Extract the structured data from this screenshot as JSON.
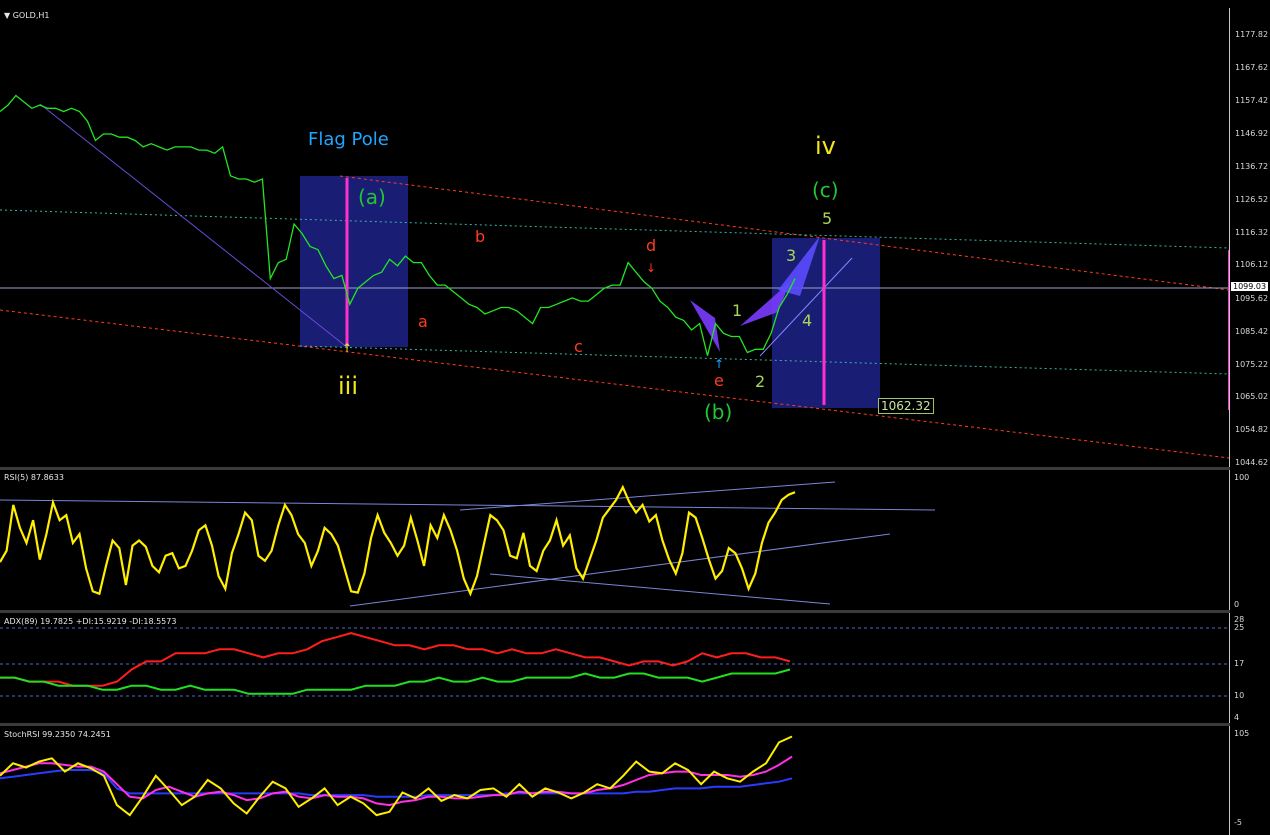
{
  "chart_data": [
    {
      "type": "line",
      "title": "GOLD,H1",
      "y_ticks": [
        "1177.82",
        "1167.62",
        "1157.42",
        "1146.92",
        "1136.72",
        "1126.52",
        "1116.32",
        "1106.12",
        "1095.62",
        "1085.42",
        "1075.22",
        "1065.02",
        "1054.82",
        "1044.62"
      ],
      "ylim": [
        1044.62,
        1177.82
      ],
      "current_price": "1099.03",
      "target_label": "1062.32",
      "annotations": {
        "flag_pole": "Flag Pole",
        "wave_iv": "iv",
        "wave_iii": "iii",
        "wave_a_paren": "(a)",
        "wave_b_paren": "(b)",
        "wave_c_paren": "(c)",
        "a": "a",
        "b": "b",
        "c": "c",
        "d": "d",
        "e": "e",
        "n1": "1",
        "n2": "2",
        "n3": "3",
        "n4": "4",
        "n5": "5"
      },
      "price_series": [
        1154,
        1156,
        1159,
        1157,
        1155,
        1156,
        1155,
        1155,
        1154,
        1155,
        1154,
        1151,
        1145,
        1147,
        1147,
        1146,
        1146,
        1145,
        1143,
        1144,
        1143,
        1142,
        1143,
        1143,
        1143,
        1142,
        1142,
        1141,
        1143,
        1134,
        1133,
        1133,
        1132,
        1133,
        1102,
        1107,
        1108,
        1119,
        1116,
        1112,
        1111,
        1106,
        1102,
        1103,
        1094,
        1099,
        1101,
        1103,
        1104,
        1108,
        1106,
        1109,
        1107,
        1107,
        1103,
        1100,
        1100,
        1098,
        1096,
        1094,
        1093,
        1091,
        1092,
        1093,
        1093,
        1092,
        1090,
        1088,
        1093,
        1093,
        1094,
        1095,
        1096,
        1095,
        1095,
        1097,
        1099,
        1100,
        1100,
        1107,
        1104,
        1101,
        1099,
        1095,
        1093,
        1090,
        1089,
        1086,
        1088,
        1078,
        1088,
        1085,
        1084,
        1084,
        1079,
        1080,
        1080,
        1085,
        1093,
        1097,
        1102
      ],
      "colors": {
        "price": "#22e622",
        "channel": "#ff3b1f",
        "dotted": "#38b3a8",
        "box": "#1b1f7a",
        "pink": "#ff2fd0",
        "fib": "#7a3cff",
        "label_green": "#22c535",
        "label_yellow": "#f2e61a",
        "label_red": "#ff3b1f",
        "label_blue": "#1fa6ff"
      }
    },
    {
      "type": "line",
      "title": "RSI(5) 87.8633",
      "y_ticks": [
        "100",
        "0"
      ],
      "ylim": [
        0,
        100
      ],
      "values": [
        33,
        42,
        78,
        60,
        48,
        66,
        35,
        55,
        80,
        66,
        70,
        48,
        55,
        28,
        10,
        8,
        30,
        50,
        44,
        15,
        46,
        50,
        45,
        30,
        25,
        38,
        40,
        28,
        30,
        42,
        58,
        62,
        46,
        22,
        12,
        40,
        55,
        72,
        66,
        38,
        34,
        42,
        62,
        78,
        70,
        55,
        48,
        30,
        42,
        60,
        55,
        46,
        28,
        10,
        9,
        24,
        52,
        70,
        56,
        48,
        38,
        46,
        68,
        50,
        30,
        62,
        52,
        70,
        58,
        42,
        20,
        8,
        22,
        46,
        70,
        66,
        58,
        38,
        36,
        56,
        30,
        26,
        42,
        50,
        66,
        46,
        54,
        28,
        20,
        35,
        50,
        68,
        75,
        82,
        92,
        80,
        72,
        78,
        65,
        70,
        50,
        35,
        24,
        40,
        72,
        68,
        52,
        35,
        20,
        26,
        44,
        40,
        28,
        12,
        24,
        48,
        64,
        72,
        82,
        86,
        88
      ],
      "color": "#ffee00"
    },
    {
      "type": "line",
      "title": "ADX(89) 19.7825 +DI:15.9219 -DI:18.5573",
      "y_ticks": [
        "28",
        "25",
        "17",
        "10",
        "4"
      ],
      "ylim": [
        4,
        28
      ],
      "series": [
        {
          "name": "+DI",
          "color": "#20e020",
          "values": [
            14,
            14,
            13,
            13,
            12,
            12,
            12,
            11,
            11,
            12,
            12,
            11,
            11,
            12,
            11,
            11,
            11,
            10,
            10,
            10,
            10,
            11,
            11,
            11,
            11,
            12,
            12,
            12,
            13,
            13,
            14,
            13,
            13,
            14,
            13,
            13,
            14,
            14,
            14,
            14,
            15,
            14,
            14,
            15,
            15,
            14,
            14,
            14,
            13,
            14,
            15,
            15,
            15,
            15,
            16
          ]
        },
        {
          "name": "-DI",
          "color": "#ff1e1e",
          "values": [
            14,
            14,
            13,
            13,
            13,
            12,
            12,
            12,
            13,
            16,
            18,
            18,
            20,
            20,
            20,
            21,
            21,
            20,
            19,
            20,
            20,
            21,
            23,
            24,
            25,
            24,
            23,
            22,
            22,
            21,
            22,
            22,
            21,
            21,
            20,
            21,
            20,
            20,
            21,
            20,
            19,
            19,
            18,
            17,
            18,
            18,
            17,
            18,
            20,
            19,
            20,
            20,
            19,
            19,
            18
          ]
        }
      ]
    },
    {
      "type": "line",
      "title": "StochRSI 99.2350 74.2451",
      "y_ticks": [
        "105",
        "-5"
      ],
      "ylim": [
        -5,
        105
      ],
      "series": [
        {
          "name": "K",
          "color": "#ffee00",
          "values": [
            55,
            70,
            65,
            72,
            76,
            60,
            70,
            64,
            55,
            20,
            8,
            30,
            55,
            38,
            20,
            30,
            50,
            40,
            22,
            10,
            30,
            48,
            40,
            18,
            28,
            40,
            20,
            30,
            22,
            8,
            12,
            35,
            28,
            40,
            25,
            32,
            28,
            38,
            40,
            30,
            45,
            30,
            40,
            35,
            28,
            35,
            45,
            40,
            55,
            72,
            60,
            58,
            70,
            62,
            45,
            60,
            52,
            48,
            60,
            70,
            95,
            102
          ]
        },
        {
          "name": "D",
          "color": "#ff30e6",
          "values": [
            58,
            62,
            66,
            70,
            70,
            68,
            66,
            66,
            60,
            45,
            30,
            28,
            38,
            42,
            36,
            30,
            34,
            36,
            32,
            26,
            28,
            34,
            36,
            30,
            28,
            32,
            30,
            30,
            28,
            22,
            20,
            24,
            26,
            30,
            30,
            28,
            28,
            30,
            32,
            32,
            36,
            34,
            36,
            36,
            34,
            34,
            38,
            40,
            44,
            50,
            56,
            58,
            60,
            60,
            56,
            56,
            56,
            54,
            56,
            60,
            68,
            78
          ]
        },
        {
          "name": "Band",
          "color": "#2a3bff",
          "values": [
            52,
            54,
            56,
            58,
            60,
            62,
            62,
            62,
            58,
            40,
            34,
            34,
            34,
            34,
            34,
            34,
            34,
            34,
            34,
            34,
            34,
            34,
            34,
            34,
            32,
            32,
            32,
            32,
            32,
            30,
            30,
            30,
            30,
            32,
            32,
            32,
            32,
            32,
            32,
            34,
            34,
            34,
            34,
            34,
            34,
            34,
            34,
            34,
            34,
            36,
            36,
            38,
            40,
            40,
            40,
            42,
            42,
            42,
            44,
            46,
            48,
            52
          ]
        }
      ]
    }
  ]
}
